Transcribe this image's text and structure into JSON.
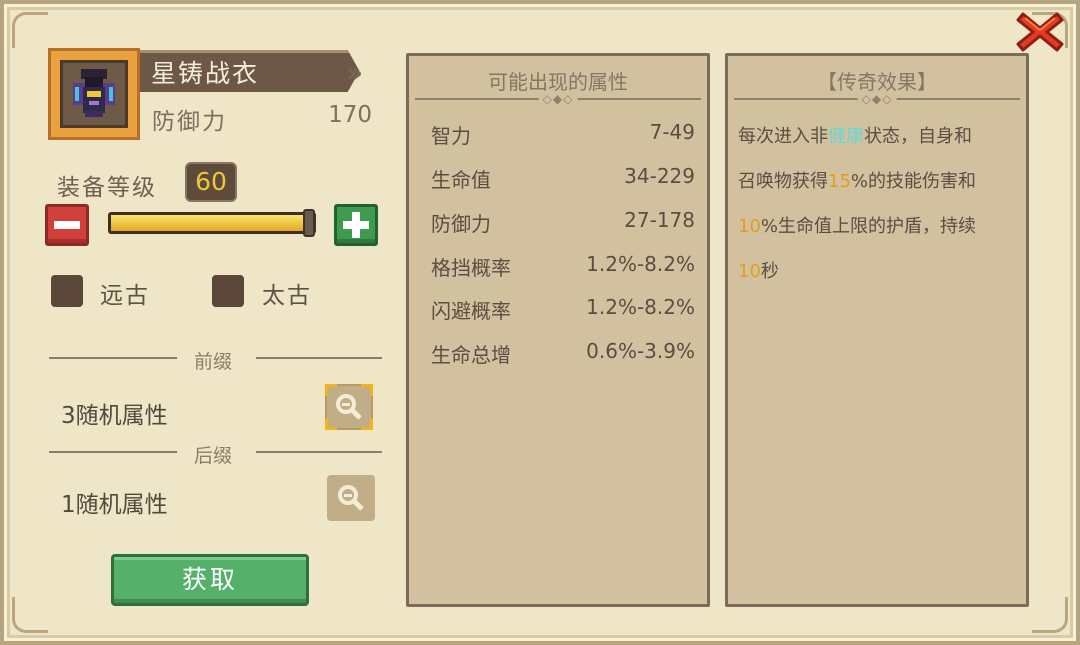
{
  "item": {
    "name": "星铸战衣",
    "stat_label": "防御力",
    "stat_value": "170"
  },
  "level": {
    "label": "装备等级",
    "value": "60",
    "slider_fraction": 1.0
  },
  "tiers": [
    {
      "label": "远古",
      "checked": false
    },
    {
      "label": "太古",
      "checked": false
    }
  ],
  "prefix": {
    "divider": "前缀",
    "text": "3随机属性"
  },
  "suffix": {
    "divider": "后缀",
    "text": "1随机属性"
  },
  "get_button": "获取",
  "possible_attributes": {
    "title": "可能出现的属性",
    "rows": [
      {
        "name": "智力",
        "range": "7-49"
      },
      {
        "name": "生命值",
        "range": "34-229"
      },
      {
        "name": "防御力",
        "range": "27-178"
      },
      {
        "name": "格挡概率",
        "range": "1.2%-8.2%"
      },
      {
        "name": "闪避概率",
        "range": "1.2%-8.2%"
      },
      {
        "name": "生命总增",
        "range": "0.6%-3.9%"
      }
    ]
  },
  "legendary": {
    "title": "【传奇效果】",
    "t1": "每次进入非",
    "t2": "健康",
    "t3": "状态，自身和",
    "t4": "召唤物获得",
    "t5": "15",
    "t6": "%的技能伤害和",
    "t7": "10",
    "t8": "%生命值上限的护盾，持续",
    "t9": "10",
    "t10": "秒"
  },
  "colors": {
    "accent_orange": "#e79b1c",
    "accent_cyan": "#6cd6d0",
    "button_green": "#55b16a",
    "button_red": "#d2403c"
  },
  "icons": {
    "close": "close-x-icon",
    "minus": "minus-icon",
    "plus": "plus-icon",
    "zoom": "magnifier-icon",
    "item": "armor-icon"
  }
}
